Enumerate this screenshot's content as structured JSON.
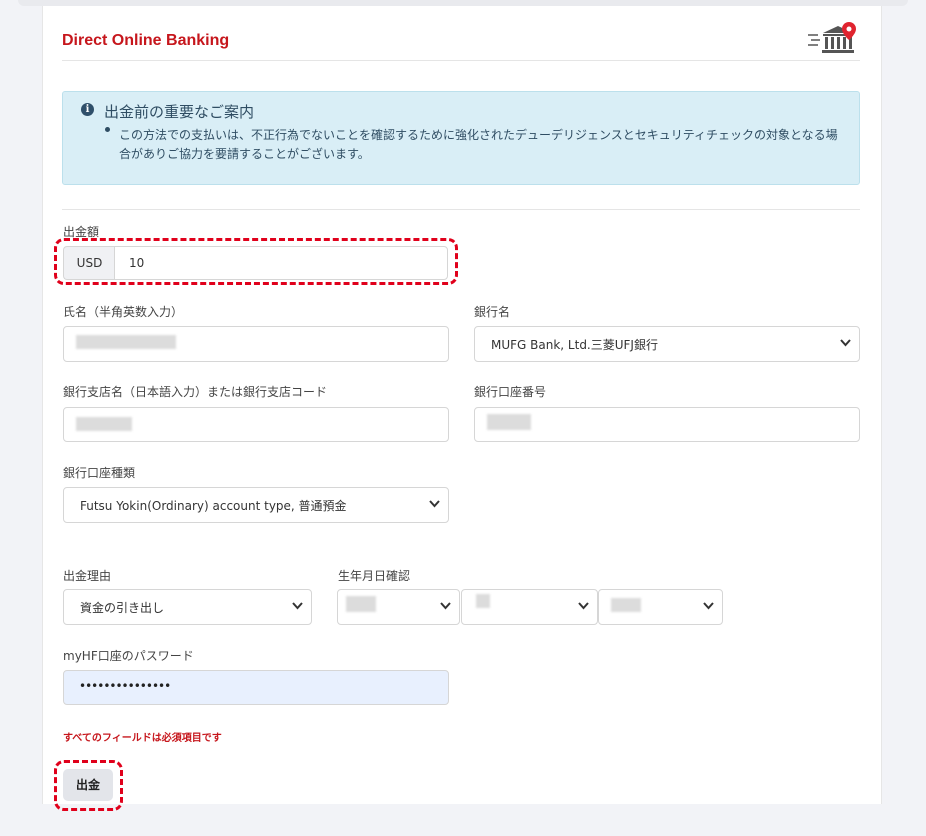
{
  "header": {
    "title": "Direct Online Banking",
    "icon": "bank-building-pin-icon",
    "accent": "#c6161c"
  },
  "notice": {
    "title": "出金前の重要なご案内",
    "text": "この方法での支払いは、不正行為でないことを確認するために強化されたデューデリジェンスとセキュリティチェックの対象となる場合がありご協力を要請することがございます。"
  },
  "amount": {
    "label": "出金額",
    "currency": "USD",
    "value": "10"
  },
  "name": {
    "label": "氏名（半角英数入力）"
  },
  "bank": {
    "label": "銀行名",
    "selected": "MUFG Bank, Ltd.三菱UFJ銀行"
  },
  "branch": {
    "label": "銀行支店名（日本語入力）または銀行支店コード"
  },
  "account_number": {
    "label": "銀行口座番号"
  },
  "account_type": {
    "label": "銀行口座種類",
    "selected": "Futsu Yokin(Ordinary) account type, 普通預金"
  },
  "reason": {
    "label": "出金理由",
    "selected": "資金の引き出し"
  },
  "birthdate": {
    "label": "生年月日確認"
  },
  "password": {
    "label": "myHF口座のパスワード",
    "value": "•••••••••••••••"
  },
  "required_note": "すべてのフィールドは必須項目です",
  "submit_label": "出金"
}
